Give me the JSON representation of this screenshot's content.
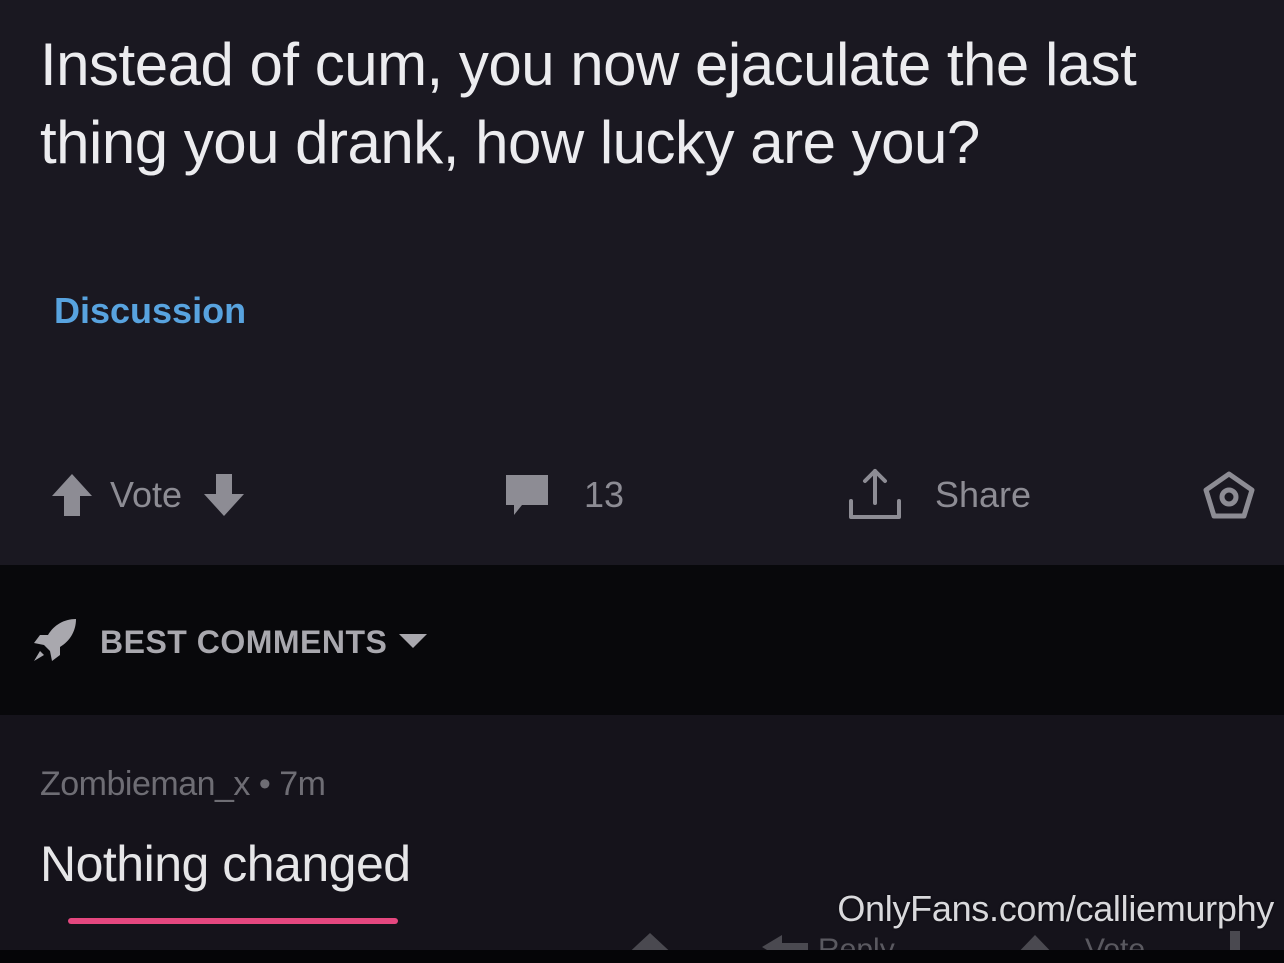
{
  "post": {
    "title": "Instead of cum, you now ejaculate the last thing you drank, how lucky are you?",
    "flair": "Discussion",
    "vote_label": "Vote",
    "comment_count": "13",
    "share_label": "Share",
    "icons": {
      "upvote": "arrow-up-icon",
      "downvote": "arrow-down-icon",
      "comments": "comment-bubble-icon",
      "share": "share-icon",
      "award": "award-icon"
    }
  },
  "sort": {
    "label": "BEST COMMENTS",
    "icon": "rocket-icon"
  },
  "comment": {
    "author": "Zombieman_x",
    "separator": "•",
    "age": "7m",
    "body": "Nothing changed",
    "reply_label": "Reply",
    "vote_label": "Vote"
  },
  "watermark": "OnlyFans.com/calliemurphy",
  "colors": {
    "flair": "#58a3df",
    "underline": "#e4477f",
    "background": "#1a1821"
  }
}
